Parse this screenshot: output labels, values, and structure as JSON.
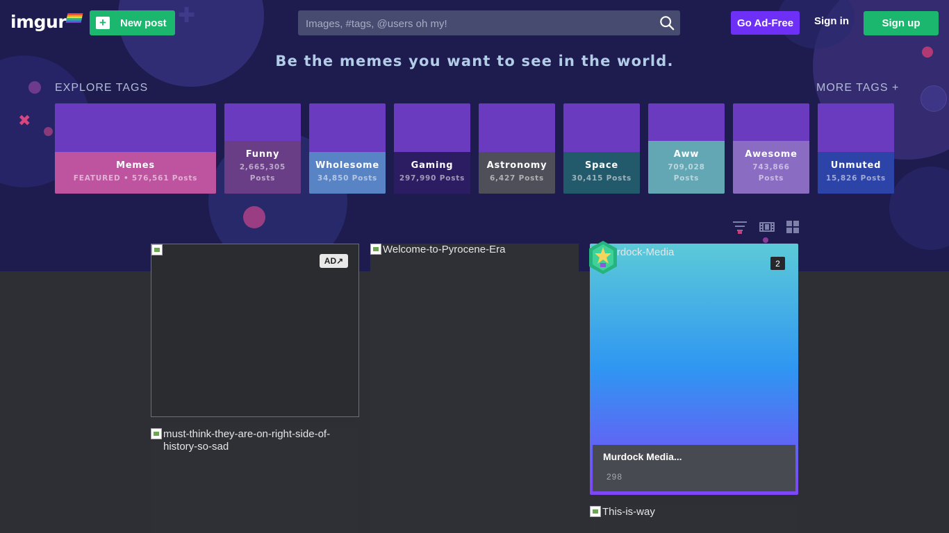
{
  "header": {
    "logo": "imgur",
    "new_post_label": "New post",
    "search_placeholder": "Images, #tags, @users oh my!",
    "go_adfree_label": "Go Ad-Free",
    "sign_in_label": "Sign in",
    "sign_up_label": "Sign up"
  },
  "hero": {
    "tagline": "Be the memes you want to see in the world.",
    "explore_label": "EXPLORE TAGS",
    "more_tags_label": "MORE TAGS +"
  },
  "tags": [
    {
      "name": "Memes",
      "count": "FEATURED • 576,561 Posts",
      "color": "#be53a0"
    },
    {
      "name": "Funny",
      "count_line1": "2,665,305",
      "count_line2": "Posts",
      "color": "#6a3e86"
    },
    {
      "name": "Wholesome",
      "count": "34,850 Posts",
      "color": "#5884c6"
    },
    {
      "name": "Gaming",
      "count": "297,990 Posts",
      "color": "#2c1d63"
    },
    {
      "name": "Astronomy",
      "count": "6,427 Posts",
      "color": "#4f4f5a"
    },
    {
      "name": "Space",
      "count": "30,415 Posts",
      "color": "#225a6c"
    },
    {
      "name": "Aww",
      "count_line1": "709,028",
      "count_line2": "Posts",
      "color": "#64a7b4"
    },
    {
      "name": "Awesome",
      "count_line1": "743,866",
      "count_line2": "Posts",
      "color": "#8a6cc2"
    },
    {
      "name": "Unmuted",
      "count": "15,826 Posts",
      "color": "#2c43a8"
    }
  ],
  "posts": {
    "ad": {
      "alt": "",
      "badge": "AD↗"
    },
    "p1": {
      "alt": "Welcome-to-Pyrocene-Era"
    },
    "promo": {
      "alt": "Murdock-Media",
      "image_count": "2",
      "title": "Murdock Media...",
      "stat": "298"
    },
    "p2": {
      "alt": "must-think-they-are-on-right-side-of-history-so-sad"
    },
    "p3": {
      "alt": "This-is-way"
    }
  }
}
